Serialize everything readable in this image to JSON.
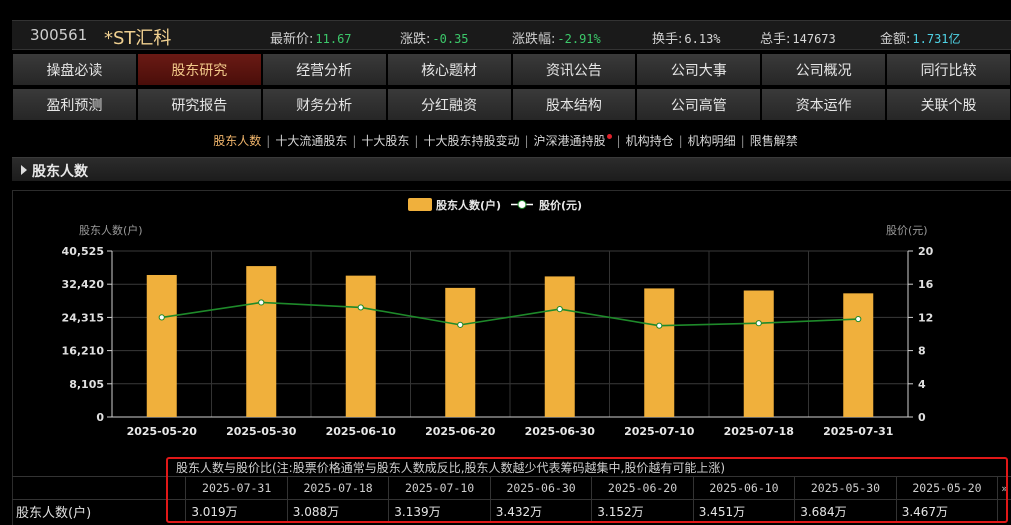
{
  "stock": {
    "code": "300561",
    "name": "*ST汇科"
  },
  "quote": [
    {
      "label": "最新价:",
      "value": "11.67",
      "color": "green"
    },
    {
      "label": "涨跌:",
      "value": "-0.35",
      "color": "green"
    },
    {
      "label": "涨跌幅:",
      "value": "-2.91%",
      "color": "green"
    },
    {
      "label": "换手:",
      "value": "6.13%",
      "color": "white"
    },
    {
      "label": "总手:",
      "value": "147673",
      "color": "white"
    },
    {
      "label": "金额:",
      "value": "1.731亿",
      "color": "cyan"
    }
  ],
  "nav": {
    "row1": [
      "操盘必读",
      "股东研究",
      "经营分析",
      "核心题材",
      "资讯公告",
      "公司大事",
      "公司概况",
      "同行比较"
    ],
    "row2": [
      "盈利预测",
      "研究报告",
      "财务分析",
      "分红融资",
      "股本结构",
      "公司高管",
      "资本运作",
      "关联个股"
    ],
    "active": "股东研究"
  },
  "subtabs": [
    "股东人数",
    "十大流通股东",
    "十大股东",
    "十大股东持股变动",
    "沪深港通持股",
    "机构持仓",
    "机构明细",
    "限售解禁"
  ],
  "subtab_active": "股东人数",
  "section_title": "股东人数",
  "chart_data": {
    "type": "bar",
    "legend": {
      "bar": "股东人数(户)",
      "line": "股价(元)",
      "placement": "top-center"
    },
    "ylabel_left": "股东人数(户)",
    "ylabel_right": "股价(元)",
    "yticks_left": [
      "40,525",
      "32,420",
      "24,315",
      "16,210",
      "8,105",
      "0"
    ],
    "yticks_right": [
      "20",
      "16",
      "12",
      "8",
      "4",
      "0"
    ],
    "ylim_left": [
      0,
      40525
    ],
    "ylim_right": [
      0,
      20
    ],
    "categories": [
      "2025-05-20",
      "2025-05-30",
      "2025-06-10",
      "2025-06-20",
      "2025-06-30",
      "2025-07-10",
      "2025-07-18",
      "2025-07-31"
    ],
    "series": [
      {
        "name": "股东人数(户)",
        "type": "bar",
        "values": [
          34670,
          36840,
          34510,
          31520,
          34320,
          31390,
          30880,
          30190
        ]
      },
      {
        "name": "股价(元)",
        "type": "line",
        "values": [
          12.0,
          13.8,
          13.2,
          11.1,
          13.0,
          11.0,
          11.3,
          11.8
        ]
      }
    ],
    "grid": true
  },
  "table": {
    "caption": "股东人数与股价比(注:股票价格通常与股东人数成反比,股东人数越少代表筹码越集中,股价越有可能上涨)",
    "row_label": "股东人数(户)",
    "dates": [
      "2025-07-31",
      "2025-07-18",
      "2025-07-10",
      "2025-06-30",
      "2025-06-20",
      "2025-06-10",
      "2025-05-30",
      "2025-05-20"
    ],
    "values": [
      "3.019万",
      "3.088万",
      "3.139万",
      "3.432万",
      "3.152万",
      "3.451万",
      "3.684万",
      "3.467万"
    ],
    "more": "»"
  },
  "colors": {
    "bar": "#f0b03c",
    "line": "#1e8a2a",
    "active_tab": "#5a1410",
    "highlight_frame": "#e01818"
  }
}
